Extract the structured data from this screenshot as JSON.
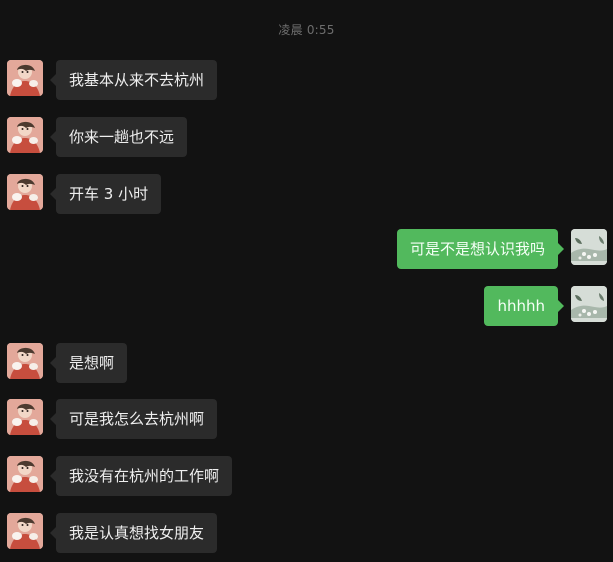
{
  "chat": {
    "timestamp": "凌晨 0:55",
    "messages": [
      {
        "side": "left",
        "text": "我基本从来不去杭州"
      },
      {
        "side": "left",
        "text": "你来一趟也不远"
      },
      {
        "side": "left",
        "text": "开车 3 小时"
      },
      {
        "side": "right",
        "text": "可是不是想认识我吗"
      },
      {
        "side": "right",
        "text": "hhhhh"
      },
      {
        "side": "left",
        "text": "是想啊"
      },
      {
        "side": "left",
        "text": "可是我怎么去杭州啊"
      },
      {
        "side": "left",
        "text": "我没有在杭州的工作啊"
      },
      {
        "side": "left",
        "text": "我是认真想找女朋友"
      }
    ]
  },
  "colors": {
    "background": "#121212",
    "incoming_bubble": "#2b2b2b",
    "outgoing_bubble": "#52b95d",
    "timestamp": "#6d6d6d"
  },
  "icons": {
    "incoming_avatar": "avatar-icon",
    "outgoing_avatar": "avatar-icon"
  }
}
